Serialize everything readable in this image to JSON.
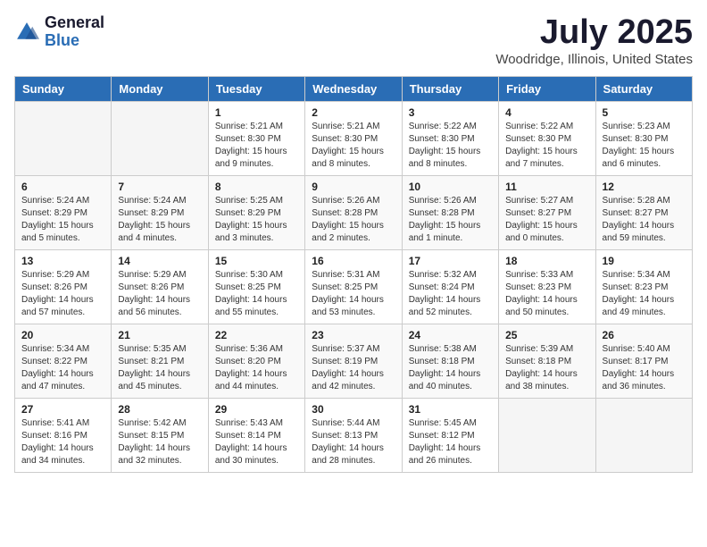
{
  "logo": {
    "general": "General",
    "blue": "Blue"
  },
  "title": "July 2025",
  "subtitle": "Woodridge, Illinois, United States",
  "weekdays": [
    "Sunday",
    "Monday",
    "Tuesday",
    "Wednesday",
    "Thursday",
    "Friday",
    "Saturday"
  ],
  "weeks": [
    [
      {
        "day": "",
        "info": ""
      },
      {
        "day": "",
        "info": ""
      },
      {
        "day": "1",
        "info": "Sunrise: 5:21 AM\nSunset: 8:30 PM\nDaylight: 15 hours and 9 minutes."
      },
      {
        "day": "2",
        "info": "Sunrise: 5:21 AM\nSunset: 8:30 PM\nDaylight: 15 hours and 8 minutes."
      },
      {
        "day": "3",
        "info": "Sunrise: 5:22 AM\nSunset: 8:30 PM\nDaylight: 15 hours and 8 minutes."
      },
      {
        "day": "4",
        "info": "Sunrise: 5:22 AM\nSunset: 8:30 PM\nDaylight: 15 hours and 7 minutes."
      },
      {
        "day": "5",
        "info": "Sunrise: 5:23 AM\nSunset: 8:30 PM\nDaylight: 15 hours and 6 minutes."
      }
    ],
    [
      {
        "day": "6",
        "info": "Sunrise: 5:24 AM\nSunset: 8:29 PM\nDaylight: 15 hours and 5 minutes."
      },
      {
        "day": "7",
        "info": "Sunrise: 5:24 AM\nSunset: 8:29 PM\nDaylight: 15 hours and 4 minutes."
      },
      {
        "day": "8",
        "info": "Sunrise: 5:25 AM\nSunset: 8:29 PM\nDaylight: 15 hours and 3 minutes."
      },
      {
        "day": "9",
        "info": "Sunrise: 5:26 AM\nSunset: 8:28 PM\nDaylight: 15 hours and 2 minutes."
      },
      {
        "day": "10",
        "info": "Sunrise: 5:26 AM\nSunset: 8:28 PM\nDaylight: 15 hours and 1 minute."
      },
      {
        "day": "11",
        "info": "Sunrise: 5:27 AM\nSunset: 8:27 PM\nDaylight: 15 hours and 0 minutes."
      },
      {
        "day": "12",
        "info": "Sunrise: 5:28 AM\nSunset: 8:27 PM\nDaylight: 14 hours and 59 minutes."
      }
    ],
    [
      {
        "day": "13",
        "info": "Sunrise: 5:29 AM\nSunset: 8:26 PM\nDaylight: 14 hours and 57 minutes."
      },
      {
        "day": "14",
        "info": "Sunrise: 5:29 AM\nSunset: 8:26 PM\nDaylight: 14 hours and 56 minutes."
      },
      {
        "day": "15",
        "info": "Sunrise: 5:30 AM\nSunset: 8:25 PM\nDaylight: 14 hours and 55 minutes."
      },
      {
        "day": "16",
        "info": "Sunrise: 5:31 AM\nSunset: 8:25 PM\nDaylight: 14 hours and 53 minutes."
      },
      {
        "day": "17",
        "info": "Sunrise: 5:32 AM\nSunset: 8:24 PM\nDaylight: 14 hours and 52 minutes."
      },
      {
        "day": "18",
        "info": "Sunrise: 5:33 AM\nSunset: 8:23 PM\nDaylight: 14 hours and 50 minutes."
      },
      {
        "day": "19",
        "info": "Sunrise: 5:34 AM\nSunset: 8:23 PM\nDaylight: 14 hours and 49 minutes."
      }
    ],
    [
      {
        "day": "20",
        "info": "Sunrise: 5:34 AM\nSunset: 8:22 PM\nDaylight: 14 hours and 47 minutes."
      },
      {
        "day": "21",
        "info": "Sunrise: 5:35 AM\nSunset: 8:21 PM\nDaylight: 14 hours and 45 minutes."
      },
      {
        "day": "22",
        "info": "Sunrise: 5:36 AM\nSunset: 8:20 PM\nDaylight: 14 hours and 44 minutes."
      },
      {
        "day": "23",
        "info": "Sunrise: 5:37 AM\nSunset: 8:19 PM\nDaylight: 14 hours and 42 minutes."
      },
      {
        "day": "24",
        "info": "Sunrise: 5:38 AM\nSunset: 8:18 PM\nDaylight: 14 hours and 40 minutes."
      },
      {
        "day": "25",
        "info": "Sunrise: 5:39 AM\nSunset: 8:18 PM\nDaylight: 14 hours and 38 minutes."
      },
      {
        "day": "26",
        "info": "Sunrise: 5:40 AM\nSunset: 8:17 PM\nDaylight: 14 hours and 36 minutes."
      }
    ],
    [
      {
        "day": "27",
        "info": "Sunrise: 5:41 AM\nSunset: 8:16 PM\nDaylight: 14 hours and 34 minutes."
      },
      {
        "day": "28",
        "info": "Sunrise: 5:42 AM\nSunset: 8:15 PM\nDaylight: 14 hours and 32 minutes."
      },
      {
        "day": "29",
        "info": "Sunrise: 5:43 AM\nSunset: 8:14 PM\nDaylight: 14 hours and 30 minutes."
      },
      {
        "day": "30",
        "info": "Sunrise: 5:44 AM\nSunset: 8:13 PM\nDaylight: 14 hours and 28 minutes."
      },
      {
        "day": "31",
        "info": "Sunrise: 5:45 AM\nSunset: 8:12 PM\nDaylight: 14 hours and 26 minutes."
      },
      {
        "day": "",
        "info": ""
      },
      {
        "day": "",
        "info": ""
      }
    ]
  ]
}
